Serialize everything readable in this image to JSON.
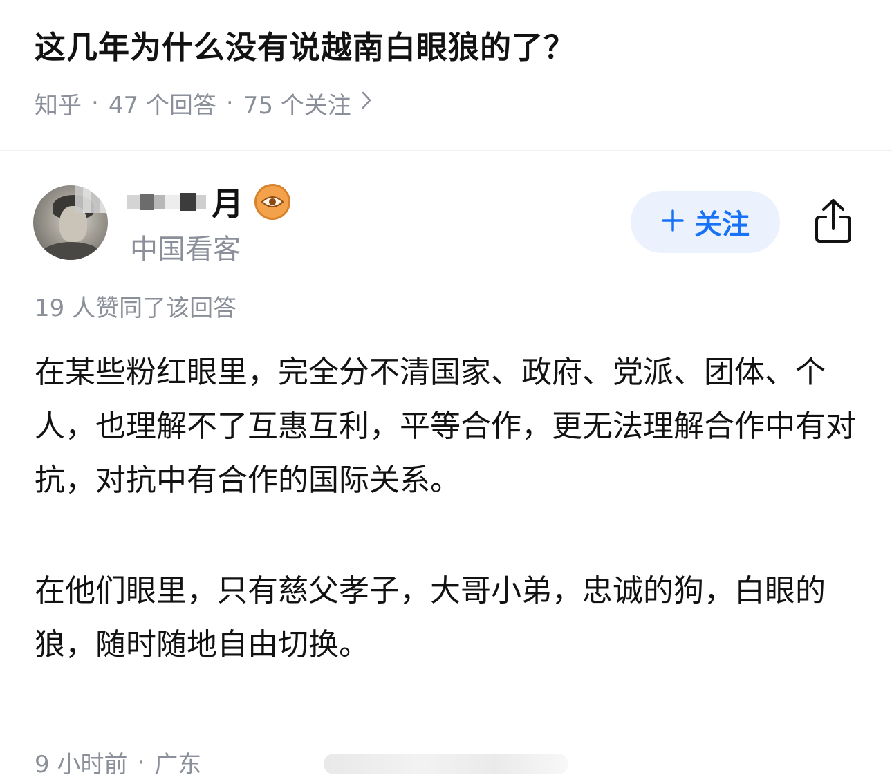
{
  "question": {
    "title": "这几年为什么没有说越南白眼狼的了？",
    "source": "知乎",
    "answers_count": "47 个回答",
    "followers_count": "75 个关注",
    "separator": "·"
  },
  "author": {
    "name_visible": "月",
    "title": "中国看客",
    "follow_label": "关注",
    "follow_icon": "plus-icon",
    "badge_icon": "eye-badge-icon",
    "share_icon": "share-icon"
  },
  "answer": {
    "upvote_text": "19 人赞同了该回答",
    "paragraphs": [
      "在某些粉红眼里，完全分不清国家、政府、党派、团体、个人，也理解不了互惠互利，平等合作，更无法理解合作中有对抗，对抗中有合作的国际关系。",
      "在他们眼里，只有慈父孝子，大哥小弟，忠诚的狗，白眼的狼，随时随地自由切换。"
    ],
    "time": "9 小时前",
    "location": "广东",
    "separator": "·"
  },
  "colors": {
    "accent": "#1772f6",
    "follow_bg": "#ebf2fe",
    "muted_text": "#8a8f99",
    "badge": "#f3a24b"
  }
}
